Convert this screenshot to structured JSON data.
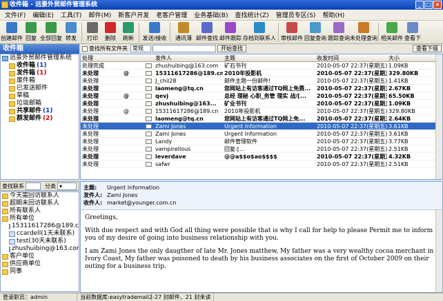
{
  "window": {
    "title": "收件箱 - 远景外贸邮件管理系统"
  },
  "menu": [
    "文件(F)",
    "编辑(E)",
    "工具(T)",
    "邮件(M)",
    "新客户开发",
    "老客户管理",
    "业务基础(B)",
    "查找统计(Z)",
    "管理员专区(S)",
    "帮助(H)"
  ],
  "toolbar": [
    {
      "label": "创建邮件",
      "icon": "compose-icon",
      "color": "#3a78c9"
    },
    {
      "label": "回复",
      "icon": "reply-icon",
      "color": "#3a9a4a"
    },
    {
      "label": "全部回复",
      "icon": "reply-all-icon",
      "color": "#3a9a4a"
    },
    {
      "label": "转发",
      "icon": "forward-icon",
      "color": "#4a8ad0"
    },
    {
      "label": "打印",
      "icon": "print-icon",
      "color": "#6a6a6a"
    },
    {
      "label": "删除",
      "icon": "delete-icon",
      "color": "#d02a2a"
    },
    {
      "label": "刷新",
      "icon": "refresh-icon",
      "color": "#2a9a6a"
    },
    {
      "label": "发送/接收",
      "icon": "send-receive-icon",
      "color": "#3a78c9"
    },
    {
      "label": "通讯薄",
      "icon": "address-book-icon",
      "color": "#c08a2a"
    },
    {
      "label": "邮件查找",
      "icon": "mail-search-icon",
      "color": "#5a6ac9"
    },
    {
      "label": "邮件跟踪",
      "icon": "mail-track-icon",
      "color": "#9a4ac9"
    },
    {
      "label": "存档到联系人",
      "icon": "archive-contact-icon",
      "color": "#2a8ac9"
    },
    {
      "label": "审核邮件",
      "icon": "audit-mail-icon",
      "color": "#c94a4a"
    },
    {
      "label": "回复查询",
      "icon": "reply-query-icon",
      "color": "#4a9ac9"
    },
    {
      "label": "跟踪查询",
      "icon": "track-query-icon",
      "color": "#9a6ac9"
    },
    {
      "label": "未处理查询",
      "icon": "pending-query-icon",
      "color": "#c97a2a"
    },
    {
      "label": "相关邮件",
      "icon": "related-mail-icon",
      "color": "#4aa94a"
    },
    {
      "label": "查看下",
      "icon": "view-more-icon",
      "color": "#6a8ac9"
    }
  ],
  "folders": {
    "header": "收件箱",
    "root": "远景外贸邮件管理系统",
    "items": [
      {
        "label": "收件箱",
        "count": "(1)",
        "bold": true,
        "countColor": "blue"
      },
      {
        "label": "发件箱",
        "count": "(1)",
        "bold": true,
        "countColor": "red"
      },
      {
        "label": "废件箱",
        "count": "",
        "bold": false
      },
      {
        "label": "已发送邮件",
        "count": "",
        "bold": false
      },
      {
        "label": "草稿",
        "count": "",
        "bold": false
      },
      {
        "label": "垃圾邮箱",
        "count": "",
        "bold": false
      },
      {
        "label": "共享邮件",
        "count": "(1)",
        "bold": true,
        "countColor": "blue"
      },
      {
        "label": "群发邮件",
        "count": "(2)",
        "bold": true,
        "countColor": "red"
      }
    ]
  },
  "contacts": {
    "search_label": "查找联系",
    "group_label": "分类",
    "items": [
      {
        "label": "今天需回访联系人",
        "level": 0
      },
      {
        "label": "超期未回访联系人",
        "level": 0
      },
      {
        "label": "所有联系人",
        "level": 0
      },
      {
        "label": "所有单位",
        "level": 0
      },
      {
        "label": "15311617286@189.c",
        "level": 1
      },
      {
        "label": "ccardell(1天未联系)",
        "level": 1
      },
      {
        "label": "test(30天未联系)",
        "level": 1
      },
      {
        "label": "zhushuibing@163.com",
        "level": 1
      },
      {
        "label": "客户单位",
        "level": 0
      },
      {
        "label": "供应商单位",
        "level": 0
      },
      {
        "label": "同事",
        "level": 0
      }
    ]
  },
  "filter": {
    "search_all_label": "查找所有文件夹",
    "mode_value": "常规",
    "start_label": "开始查找",
    "view_more": "查看下级"
  },
  "list": {
    "columns": [
      "处理",
      "",
      "",
      "",
      "发件人",
      "主题",
      "收发时间",
      "大小"
    ],
    "rows": [
      {
        "status": "处理完成",
        "att": "",
        "from": "zhushuibing@163.com",
        "subject": "矿石书刊",
        "time": "2010-05-07 22:37(星期五)",
        "size": "1.09KB",
        "unread": false,
        "sel": false
      },
      {
        "status": "未处理",
        "att": "@",
        "from": "15311617286@189.cn",
        "subject": "2010年投影机",
        "time": "2010-05-07 22:37(星期五)",
        "size": "329.80KB",
        "unread": true,
        "sel": false
      },
      {
        "status": "未处理",
        "att": "",
        "from": "J_chil28",
        "subject": "邮件主题一份邮件!",
        "time": "2010-05-07 22:37(星期五)",
        "size": "1.41KB",
        "unread": false,
        "sel": false
      },
      {
        "status": "未处理",
        "att": "",
        "from": "laomeng@tq.cn",
        "subject": "您网站上有访客通过TQ网上免费...",
        "time": "2010-05-07 22:37(星期五)",
        "size": "2.67KB",
        "unread": true,
        "sel": false
      },
      {
        "status": "未处理",
        "att": "@",
        "from": "qevj",
        "subject": "总经 理秘 心职_务管 理实 战/[...",
        "time": "2010-05-07 22:37(星期五)",
        "size": "65.50KB",
        "unread": true,
        "sel": false
      },
      {
        "status": "未处理",
        "att": "",
        "from": "zhushuibing@163...",
        "subject": "矿业书刊",
        "time": "2010-05-07 22:37(星期五)",
        "size": "1.09KB",
        "unread": true,
        "sel": false
      },
      {
        "status": "未处理",
        "att": "@",
        "from": "15311617286@189.cn",
        "subject": "2010年投影机",
        "time": "2010-05-07 22:37(星期五)",
        "size": "329.80KB",
        "unread": false,
        "sel": false
      },
      {
        "status": "未处理",
        "att": "",
        "from": "laomeng@tq.cn",
        "subject": "您网站上有访客通过TQ网上免...",
        "time": "2010-05-07 22:37(星期五)",
        "size": "2.64KB",
        "unread": true,
        "sel": false
      },
      {
        "status": "未处理",
        "att": "",
        "from": "Zami Jones",
        "subject": "Urgent Information",
        "time": "2010-05-07 22:37(星期五)",
        "size": "3.61KB",
        "unread": false,
        "sel": true
      },
      {
        "status": "未处理",
        "att": "",
        "from": "Zami Jones",
        "subject": "Urgent Information",
        "time": "2010-05-07 22:37(星期五)",
        "size": "3.61KB",
        "unread": false,
        "sel": false
      },
      {
        "status": "未处理",
        "att": "",
        "from": "Landy",
        "subject": "邮件管理软件",
        "time": "2010-05-07 22:37(星期五)",
        "size": "3.77KB",
        "unread": false,
        "sel": false
      },
      {
        "status": "未处理",
        "att": "",
        "from": "vampirellous",
        "subject": "回复:[...",
        "time": "2010-05-07 22:37(星期五)",
        "size": "2.51KB",
        "unread": false,
        "sel": false
      },
      {
        "status": "未处理",
        "att": "",
        "from": "leverdave",
        "subject": "@@a$$o$ao$$$$",
        "time": "2010-05-07 22:37(星期五)",
        "size": "4.32KB",
        "unread": true,
        "sel": false
      },
      {
        "status": "未处理",
        "att": "",
        "from": "safwr",
        "subject": "",
        "time": "2010-05-07 22:37(星期五)",
        "size": "2.51KB",
        "unread": false,
        "sel": false
      }
    ]
  },
  "preview": {
    "subject_label": "主题:",
    "subject": "Urgent Information",
    "from_label": "发件人:",
    "from": "Zami Jones",
    "to_label": "收件人:",
    "to": "market@younger.com.cn",
    "body": [
      "Greetings,",
      "With due respect and with God all thing were possible that is why I call for help to please Permit me to inform you of my desire of going into business relationship with you.",
      "I am Zami Jones the only daugther of late Mr. Jones matthew, My father was a very wealthy cocoa merchant in Ivory Coast, My father was poisoned to death by his business associates on the first of October 2009 on their outing for a business trip."
    ]
  },
  "status": {
    "user": "登录职员：admin",
    "db": "当前数据库:easytrademail2-",
    "counts": "27 封邮件，21 封未读"
  }
}
